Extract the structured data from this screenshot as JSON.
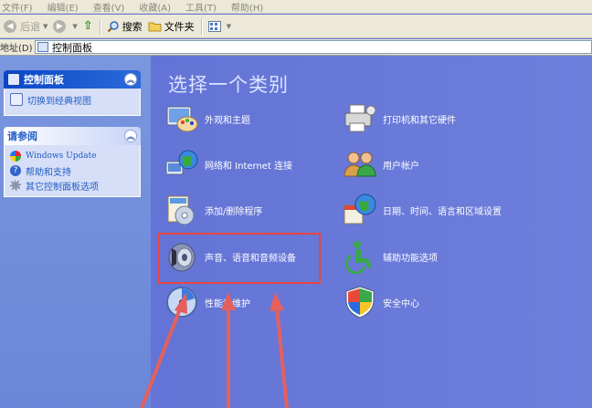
{
  "menu": [
    "文件(F)",
    "编辑(E)",
    "查看(V)",
    "收藏(A)",
    "工具(T)",
    "帮助(H)"
  ],
  "toolbar": {
    "back": "后退",
    "search": "搜索",
    "folders": "文件夹"
  },
  "address": {
    "label": "地址(D)",
    "value": "控制面板"
  },
  "left": {
    "panel1": {
      "title": "控制面板",
      "link": "切换到经典视图"
    },
    "panel2": {
      "title": "请参阅",
      "links": [
        "Windows Update",
        "帮助和支持",
        "其它控制面板选项"
      ]
    }
  },
  "main": {
    "title": "选择一个类别",
    "categories": [
      "外观和主题",
      "打印机和其它硬件",
      "网络和 Internet 连接",
      "用户帐户",
      "添加/删除程序",
      "日期、时间、语言和区域设置",
      "声音、语音和音频设备",
      "辅助功能选项",
      "性能和维护",
      "安全中心"
    ]
  },
  "colors": {
    "highlight": "#e9453f",
    "arrow": "#e5605c",
    "main_bg": "#6375d6",
    "panel_head": "#ffffff",
    "link": "#215dc6"
  }
}
